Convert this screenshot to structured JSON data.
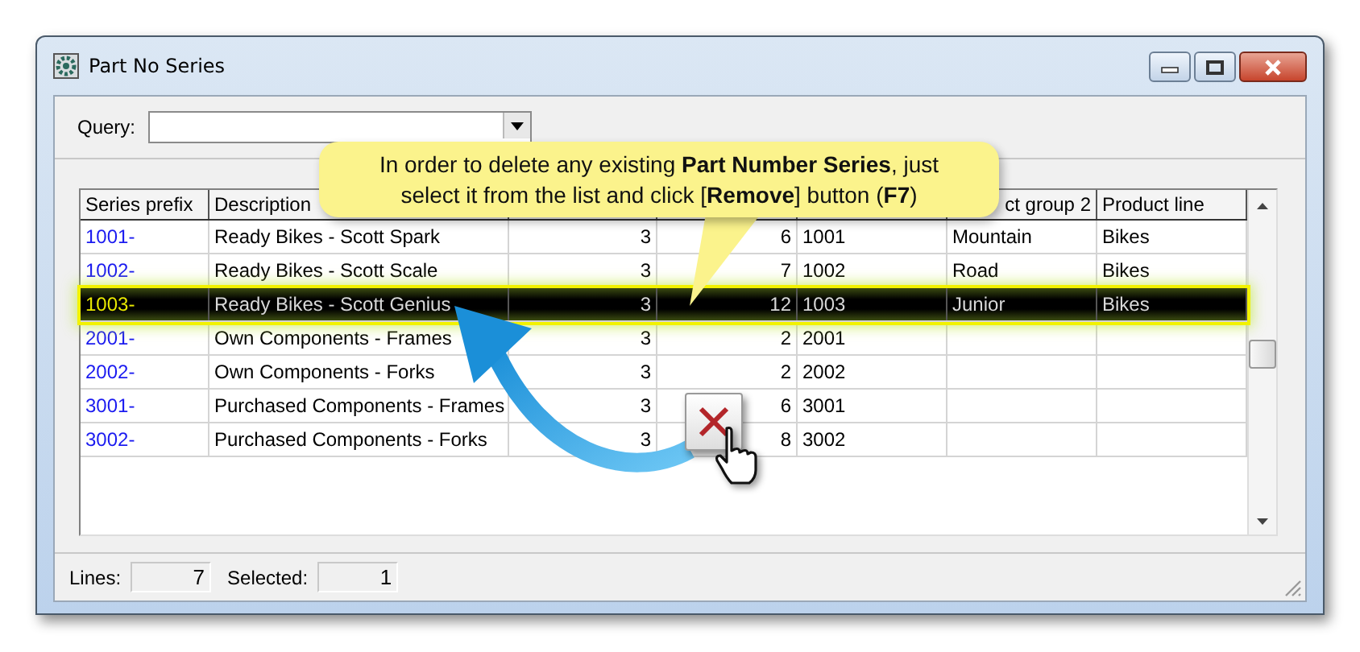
{
  "window": {
    "title": "Part No Series"
  },
  "query": {
    "label": "Query:"
  },
  "table": {
    "columns": [
      {
        "label": "Series prefix"
      },
      {
        "label": "Description"
      },
      {},
      {},
      {},
      {
        "label": "ct group 2"
      },
      {
        "label": "Product line"
      }
    ],
    "rows": [
      {
        "cells": [
          "1001-",
          "Ready Bikes - Scott Spark",
          "3",
          "6",
          "1001",
          "Mountain",
          "Bikes"
        ],
        "selected": false
      },
      {
        "cells": [
          "1002-",
          "Ready Bikes - Scott Scale",
          "3",
          "7",
          "1002",
          "Road",
          "Bikes"
        ],
        "selected": false
      },
      {
        "cells": [
          "1003-",
          "Ready Bikes - Scott Genius",
          "3",
          "12",
          "1003",
          "Junior",
          "Bikes"
        ],
        "selected": true
      },
      {
        "cells": [
          "2001-",
          "Own Components - Frames",
          "3",
          "2",
          "2001"
        ],
        "selected": false
      },
      {
        "cells": [
          "2002-",
          "Own Components - Forks",
          "3",
          "2",
          "2002"
        ],
        "selected": false
      },
      {
        "cells": [
          "3001-",
          "Purchased Components - Frames",
          "3",
          "6",
          "3001"
        ],
        "selected": false
      },
      {
        "cells": [
          "3002-",
          "Purchased Components - Forks",
          "3",
          "8",
          "3002"
        ],
        "selected": false
      }
    ]
  },
  "status_bar": {
    "lines_label": "Lines:",
    "lines": "7",
    "selected_label": "Selected:",
    "selected": "1"
  },
  "callout": {
    "text": "In order to delete any existing **Part Number Series**, just select it from the list and click [**Remove**] button (**F7**)"
  }
}
